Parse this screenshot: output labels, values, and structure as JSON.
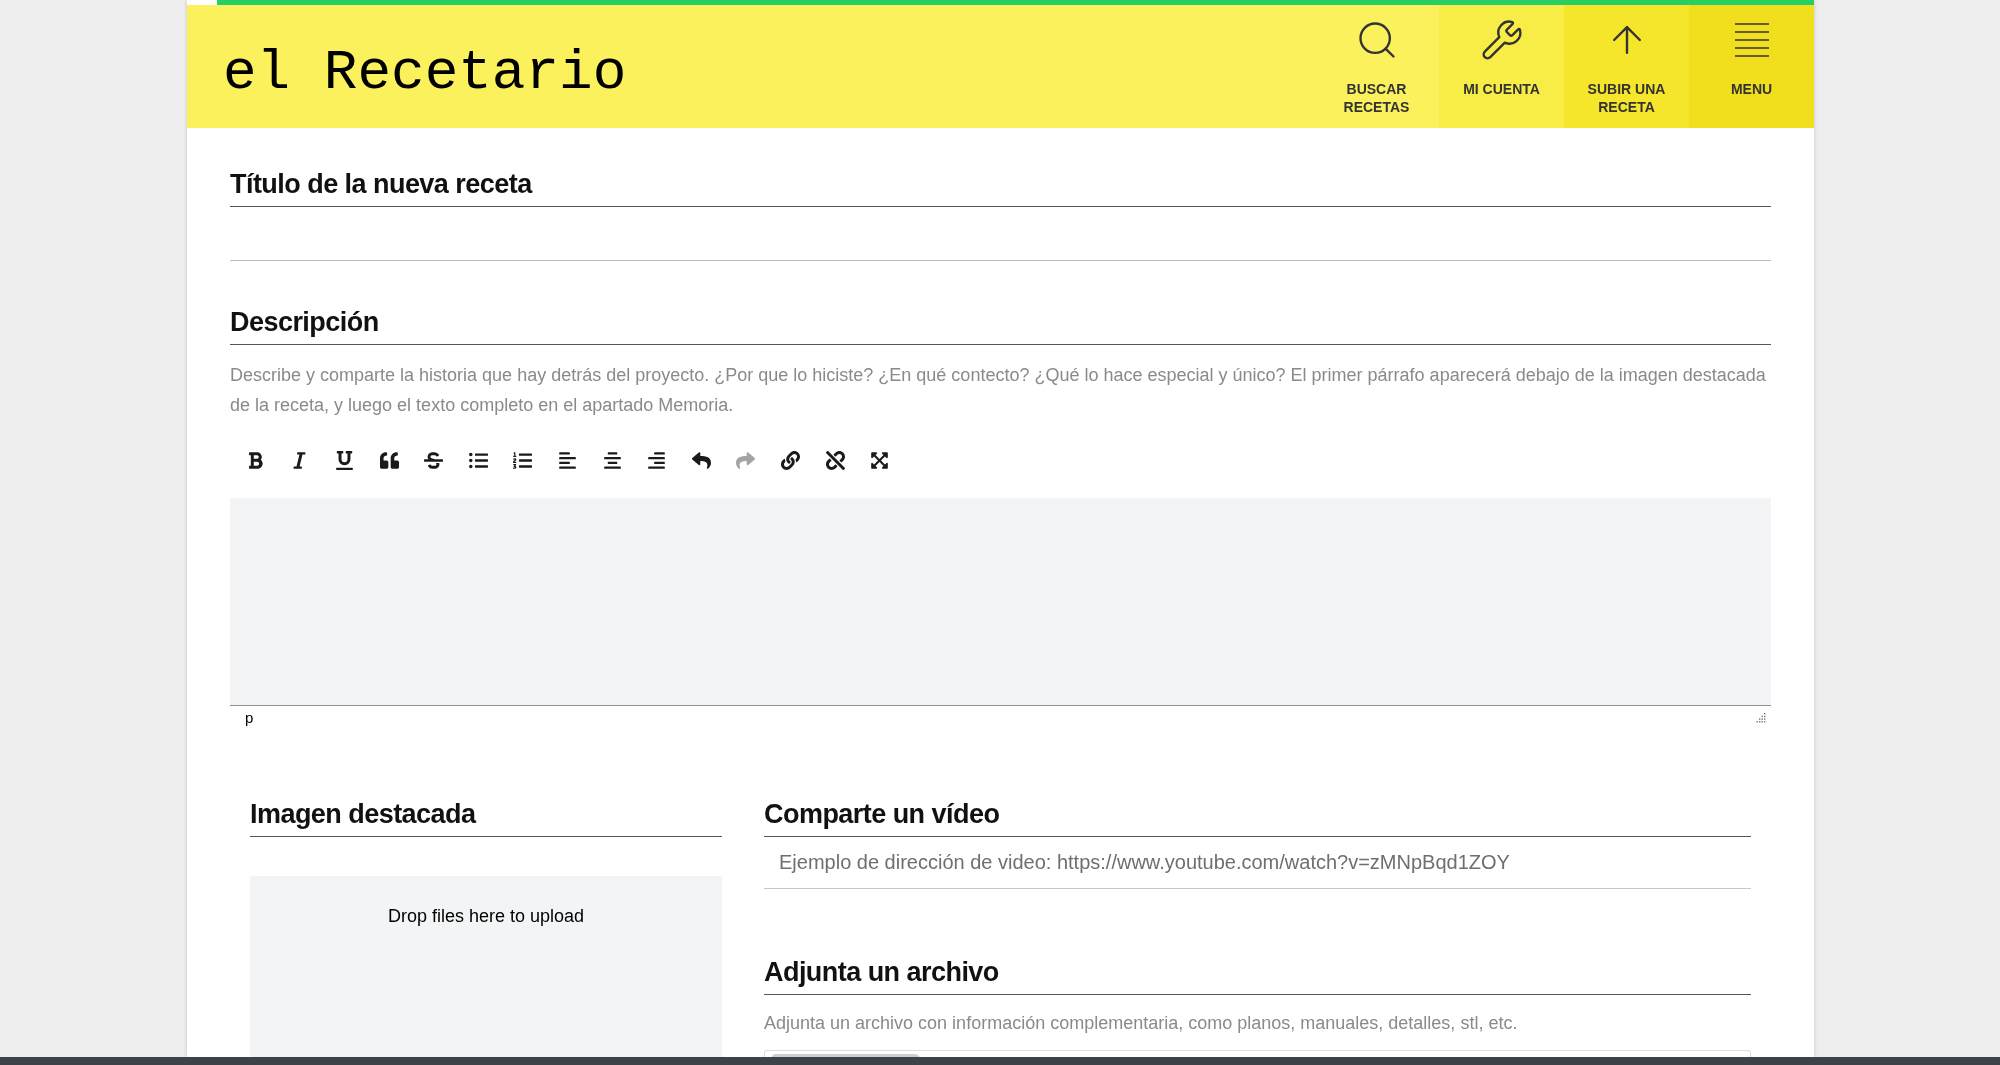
{
  "header": {
    "logo": "el Recetario",
    "nav": [
      {
        "kind": "search",
        "label": "BUSCAR RECETAS",
        "color": "#faf15c"
      },
      {
        "kind": "wrench",
        "label": "MI CUENTA",
        "color": "#f8ec47"
      },
      {
        "kind": "upload",
        "label": "SUBIR UNA RECETA",
        "color": "#f5e52b"
      },
      {
        "kind": "menu",
        "label": "MENU",
        "color": "#f1de1c"
      }
    ]
  },
  "title_section": {
    "heading": "Título de la nueva receta"
  },
  "description": {
    "heading": "Descripción",
    "hint": "Describe y comparte la historia que hay detrás del proyecto. ¿Por que lo hiciste? ¿En qué contecto? ¿Qué lo hace especial y único? El primer párrafo aparecerá debajo de la imagen destacada de la receta, y luego el texto completo en el apartado Memoria.",
    "toolbar": [
      {
        "kind": "bold",
        "disabled": false
      },
      {
        "kind": "italic",
        "disabled": false
      },
      {
        "kind": "underline",
        "disabled": false
      },
      {
        "kind": "quote",
        "disabled": false
      },
      {
        "kind": "strike",
        "disabled": false
      },
      {
        "kind": "bullets",
        "disabled": false
      },
      {
        "kind": "numbers",
        "disabled": false
      },
      {
        "kind": "left",
        "disabled": false
      },
      {
        "kind": "center",
        "disabled": false
      },
      {
        "kind": "right",
        "disabled": false
      },
      {
        "kind": "undo",
        "disabled": false
      },
      {
        "kind": "redo",
        "disabled": true
      },
      {
        "kind": "link",
        "disabled": false
      },
      {
        "kind": "unlink",
        "disabled": false
      },
      {
        "kind": "fullscreen",
        "disabled": false
      }
    ],
    "path": "p"
  },
  "image": {
    "heading": "Imagen destacada",
    "dropzone": "Drop files here to upload"
  },
  "video": {
    "heading": "Comparte un vídeo",
    "placeholder": "Ejemplo de dirección de video: https://www.youtube.com/watch?v=zMNpBqd1ZOY"
  },
  "attachment": {
    "heading": "Adjunta un archivo",
    "hint": "Adjunta un archivo con información complementaria, como planos, manuales, detalles, stl, etc."
  }
}
